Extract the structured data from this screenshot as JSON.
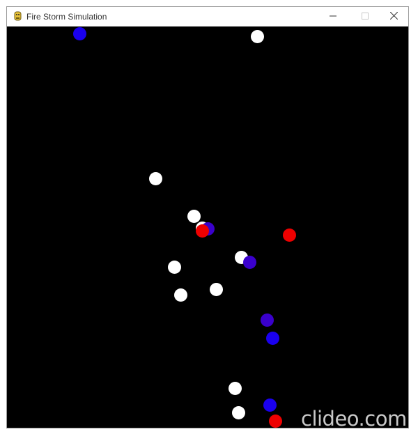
{
  "window": {
    "title": "Fire Storm Simulation",
    "controls": {
      "minimize": "minimize-icon",
      "maximize": "maximize-icon",
      "close": "close-icon"
    }
  },
  "watermark": "clideo.com",
  "colors": {
    "background": "#000000",
    "white": "#ffffff",
    "red": "#ee0000",
    "blue": "#1a00ee",
    "purple": "#3a00cc"
  },
  "particles": [
    {
      "color": "blue"
    },
    {
      "color": "white"
    },
    {
      "color": "white"
    },
    {
      "color": "white"
    },
    {
      "color": "white"
    },
    {
      "color": "purple"
    },
    {
      "color": "red"
    },
    {
      "color": "red"
    },
    {
      "color": "white"
    },
    {
      "color": "purple"
    },
    {
      "color": "white"
    },
    {
      "color": "white"
    },
    {
      "color": "white"
    },
    {
      "color": "purple"
    },
    {
      "color": "blue"
    },
    {
      "color": "white"
    },
    {
      "color": "blue"
    },
    {
      "color": "white"
    },
    {
      "color": "red"
    }
  ]
}
